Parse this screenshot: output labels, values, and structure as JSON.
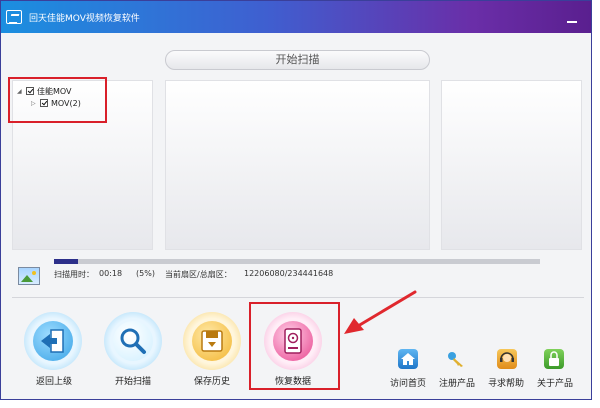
{
  "window": {
    "title": "回天佳能MOV视频恢复软件"
  },
  "scan_header": {
    "label": "开始扫描"
  },
  "tree": {
    "root": {
      "label": "佳能MOV",
      "checked": true
    },
    "child": {
      "label": "MOV(2)",
      "checked": true
    }
  },
  "progress": {
    "fraction": 0.05
  },
  "status": {
    "elapsed_label": "扫描用时：",
    "elapsed_value": "00:18",
    "percent": "(5%)",
    "sector_label": "当前扇区/总扇区：",
    "sector_value": "12206080/234441648"
  },
  "buttons": {
    "back": "返回上级",
    "scan": "开始扫描",
    "save_history": "保存历史",
    "recover": "恢复数据"
  },
  "links": {
    "home": "访问首页",
    "register": "注册产品",
    "help": "寻求帮助",
    "about": "关于产品"
  },
  "icons": {
    "app": "app-logo-icon",
    "back": "exit-door-icon",
    "scan": "magnifier-icon",
    "save": "floppy-disk-icon",
    "recover": "hard-drive-icon",
    "home": "house-icon",
    "register": "key-icon",
    "help": "headset-icon",
    "about": "lock-icon"
  },
  "colors": {
    "title_start": "#1b8fe0",
    "title_end": "#5a1f8f",
    "highlight": "#d9202a",
    "progress_fill": "#2c2f8a"
  }
}
